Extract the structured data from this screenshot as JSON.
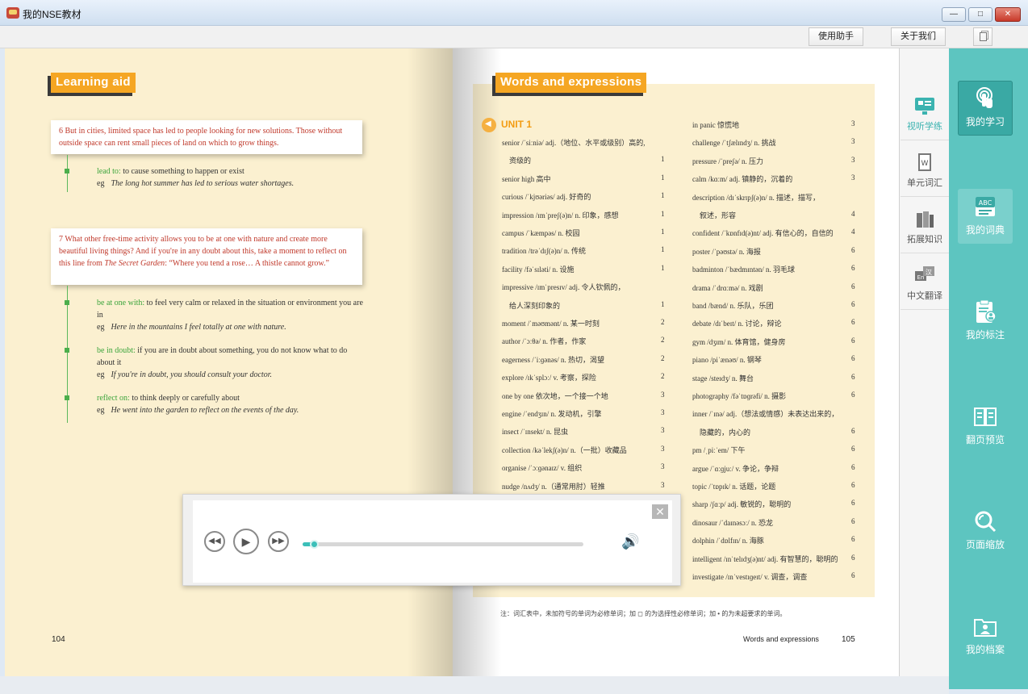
{
  "window": {
    "title": "我的NSE教材",
    "min": "—",
    "max": "□",
    "close": "✕"
  },
  "toolbar": {
    "help": "使用助手",
    "about": "关于我们"
  },
  "left_page": {
    "section_title": "Learning aid",
    "page_number": "104",
    "note6": {
      "num": "6",
      "text": "But in cities, limited space has led to people looking for new solutions. Those without outside space can rent small pieces of land on which to grow things."
    },
    "term_lead_to": {
      "hw": "lead to:",
      "def": " to cause something to happen or exist",
      "eg_label": "eg",
      "eg": "The long hot summer has led to serious water shortages."
    },
    "note7": {
      "num": "7",
      "text_a": "What other free-time activity allows you to be at one with nature and create more beautiful living things? And if you're in any doubt about this, take a moment to reflect on this line from ",
      "book": "The Secret Garden",
      "text_b": ": “Where you tend a rose… A thistle cannot grow.”"
    },
    "term_at_one": {
      "hw": "be at one with:",
      "def": " to feel very calm or relaxed in the situation or environment you are in",
      "eg_label": "eg",
      "eg": "Here in the mountains I feel totally at one with nature."
    },
    "term_in_doubt": {
      "hw": "be in doubt:",
      "def": " if you are in doubt about something, you do not know what to do about it",
      "eg_label": "eg",
      "eg": "If you're in doubt, you should consult your doctor."
    },
    "term_reflect": {
      "hw": "reflect on:",
      "def": " to think deeply or carefully about",
      "eg_label": "eg",
      "eg": "He went into the garden to reflect on the events of the day."
    }
  },
  "right_page": {
    "section_title": "Words and expressions",
    "unit": "UNIT 1",
    "footer_label": "Words and expressions",
    "page_number": "105",
    "footnote": "注：词汇表中，未加符号的单词为必修单词；加 ◻ 的为选择性必修单词；加 • 的为未超要求的单词。",
    "col1": [
      {
        "w": "senior /ˈsiːniə/ adj.（地位、水平或级别）高的,",
        "n": ""
      },
      {
        "w": "　资级的",
        "n": "1"
      },
      {
        "w": "senior high  高中",
        "n": "1"
      },
      {
        "w": "curious /ˈkjʊəriəs/ adj. 好奇的",
        "n": "1"
      },
      {
        "w": "impression /ɪmˈpreʃ(ə)n/ n. 印象，感想",
        "n": "1"
      },
      {
        "w": "campus /ˈkæmpəs/ n. 校园",
        "n": "1"
      },
      {
        "w": "tradition /trəˈdɪʃ(ə)n/ n. 传统",
        "n": "1"
      },
      {
        "w": "facility /fəˈsɪləti/ n. 设施",
        "n": "1"
      },
      {
        "w": "impressive /ɪmˈpresɪv/ adj. 令人钦佩的，",
        "n": ""
      },
      {
        "w": "　给人深刻印象的",
        "n": "1"
      },
      {
        "w": "moment /ˈməʊmənt/ n. 某一时刻",
        "n": "2"
      },
      {
        "w": "author /ˈɔːθə/ n. 作者，作家",
        "n": "2"
      },
      {
        "w": "eagerness /ˈiːɡənəs/ n. 热切，渴望",
        "n": "2"
      },
      {
        "w": "explore /ɪkˈsplɔː/ v. 考察，探险",
        "n": "2"
      },
      {
        "w": "one by one  依次地，一个接一个地",
        "n": "3"
      },
      {
        "w": "engine /ˈendʒɪn/ n. 发动机，引擎",
        "n": "3"
      },
      {
        "w": "insect /ˈɪnsekt/ n. 昆虫",
        "n": "3"
      },
      {
        "w": "collection /kəˈlekʃ(ə)n/ n.（一批）收藏品",
        "n": "3"
      },
      {
        "w": "organise /ˈɔːɡənaɪz/ v. 组织",
        "n": "3"
      },
      {
        "w": "nudge /nʌdʒ/ n.（通常用肘）轻推",
        "n": "3"
      },
      {
        "w": "",
        "n": ""
      }
    ],
    "col2": [
      {
        "w": "in panic  惊慌地",
        "n": "3"
      },
      {
        "w": "challenge /ˈtʃælɪndʒ/ n. 挑战",
        "n": "3"
      },
      {
        "w": "pressure /ˈpreʃə/ n. 压力",
        "n": "3"
      },
      {
        "w": "calm /kɑːm/ adj. 镇静的，沉着的",
        "n": "3"
      },
      {
        "w": "description /dɪˈskrɪpʃ(ə)n/ n. 描述，描写，",
        "n": ""
      },
      {
        "w": "　叙述，形容",
        "n": "4"
      },
      {
        "w": "confident /ˈkɒnfɪd(ə)nt/ adj. 有信心的，自信的",
        "n": "4"
      },
      {
        "w": "poster /ˈpəʊstə/ n. 海报",
        "n": "6"
      },
      {
        "w": "badminton /ˈbædmɪntən/ n. 羽毛球",
        "n": "6"
      },
      {
        "w": "drama /ˈdrɑːmə/ n. 戏剧",
        "n": "6"
      },
      {
        "w": "band /bænd/ n. 乐队，乐团",
        "n": "6"
      },
      {
        "w": "debate /dɪˈbeɪt/ n. 讨论，辩论",
        "n": "6"
      },
      {
        "w": "gym /dʒɪm/ n. 体育馆，健身房",
        "n": "6"
      },
      {
        "w": "piano /piˈænəʊ/ n. 钢琴",
        "n": "6"
      },
      {
        "w": "stage /steɪdʒ/ n. 舞台",
        "n": "6"
      },
      {
        "w": "photography /fəˈtɒɡrəfi/ n. 摄影",
        "n": "6"
      },
      {
        "w": "inner /ˈɪnə/ adj.（想法或情感）未表达出来的，",
        "n": ""
      },
      {
        "w": "　隐藏的，内心的",
        "n": "6"
      },
      {
        "w": "pm /ˌpiːˈem/  下午",
        "n": "6"
      },
      {
        "w": "argue /ˈɑːɡjuː/ v. 争论，争辩",
        "n": "6"
      },
      {
        "w": "topic /ˈtɒpɪk/ n. 话题，论题",
        "n": "6"
      },
      {
        "w": "sharp /ʃɑːp/ adj. 敏锐的，聪明的",
        "n": "6"
      },
      {
        "w": "dinosaur /ˈdaɪnəsɔː/ n. 恐龙",
        "n": "6"
      },
      {
        "w": "dolphin /ˈdɒlfɪn/ n. 海豚",
        "n": "6"
      },
      {
        "w": "intelligent /ɪnˈtelɪdʒ(ə)nt/ adj. 有智慧的，聪明的",
        "n": "6"
      },
      {
        "w": "investigate /ɪnˈvestɪɡeɪt/ v. 调查，调查",
        "n": "6"
      }
    ]
  },
  "vtabs": [
    {
      "label": "视听学练",
      "icon": "screen-icon"
    },
    {
      "label": "单元词汇",
      "icon": "book-w-icon"
    },
    {
      "label": "拓展知识",
      "icon": "books-icon"
    },
    {
      "label": "中文翻译",
      "icon": "translate-icon"
    }
  ],
  "sidebar": [
    {
      "label": "我的学习",
      "icon": "touch-icon"
    },
    {
      "label": "我的词典",
      "icon": "dictionary-icon"
    },
    {
      "label": "我的标注",
      "icon": "clipboard-user-icon"
    },
    {
      "label": "翻页预览",
      "icon": "open-book-icon"
    },
    {
      "label": "页面缩放",
      "icon": "zoom-icon"
    },
    {
      "label": "我的档案",
      "icon": "folder-user-icon"
    }
  ],
  "player": {
    "progress": 0.04,
    "rewind": "◀◀",
    "play": "▶",
    "forward": "▶▶",
    "close": "✕",
    "volume": "🔊"
  },
  "colors": {
    "accent": "#5dc5c0",
    "title_orange": "#f5a623",
    "note_red": "#c0392b",
    "term_green": "#3ba43b"
  }
}
